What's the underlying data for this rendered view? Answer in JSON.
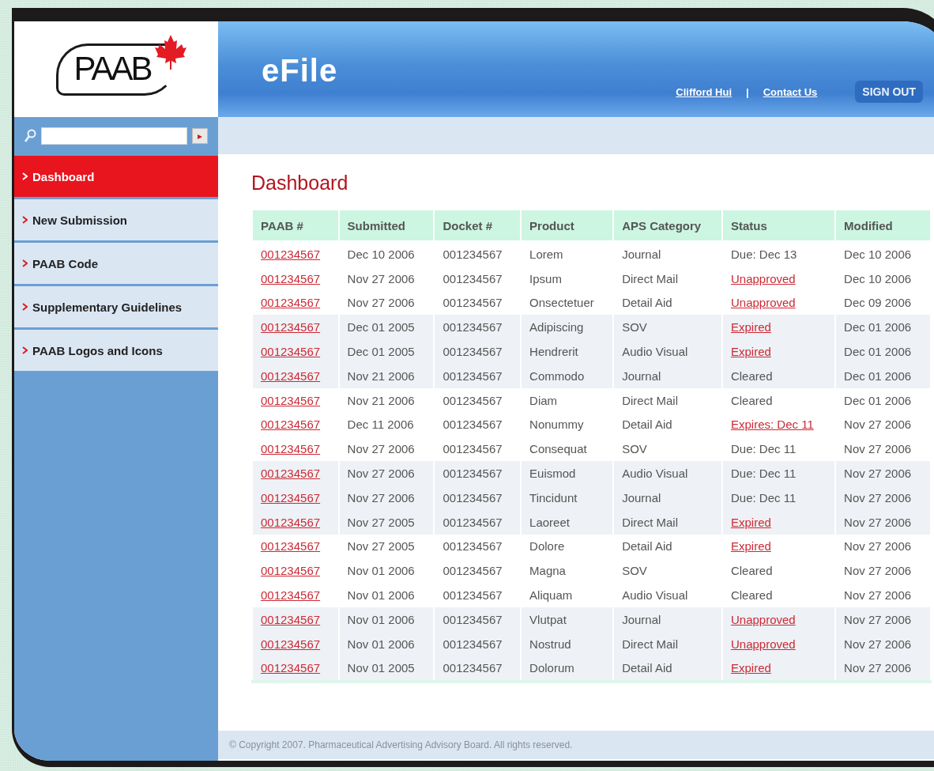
{
  "logo": {
    "text": "PAAB"
  },
  "app_title": "eFile",
  "header_links": [
    {
      "label": "Clifford Hui"
    },
    {
      "label": "Contact Us"
    }
  ],
  "header_separator": "|",
  "sign_out": "SIGN OUT",
  "search": {
    "go": "▸"
  },
  "sidebar": {
    "items": [
      {
        "label": "Dashboard",
        "selected": true
      },
      {
        "label": "New Submission",
        "selected": false
      },
      {
        "label": "PAAB Code",
        "selected": false
      },
      {
        "label": "Supplementary Guidelines",
        "selected": false
      },
      {
        "label": "PAAB Logos and Icons",
        "selected": false
      }
    ]
  },
  "page_title": "Dashboard",
  "table": {
    "columns": [
      "PAAB #",
      "Submitted",
      "Docket #",
      "Product",
      "APS Category",
      "Status",
      "Modified"
    ],
    "rows": [
      {
        "paab": "001234567",
        "submitted": "Dec 10 2006",
        "docket": "001234567",
        "product": "Lorem",
        "category": "Journal",
        "status": {
          "text": "Due: Dec 13",
          "kind": "plain"
        },
        "modified": "Dec 10 2006"
      },
      {
        "paab": "001234567",
        "submitted": "Nov 27 2006",
        "docket": "001234567",
        "product": "Ipsum",
        "category": "Direct Mail",
        "status": {
          "text": "Unapproved",
          "kind": "link"
        },
        "modified": "Dec 10 2006"
      },
      {
        "paab": "001234567",
        "submitted": "Nov 27 2006",
        "docket": "001234567",
        "product": "Onsectetuer",
        "category": "Detail Aid",
        "status": {
          "text": "Unapproved",
          "kind": "link"
        },
        "modified": "Dec 09 2006"
      },
      {
        "paab": "001234567",
        "submitted": "Dec 01 2005",
        "docket": "001234567",
        "product": "Adipiscing",
        "category": "SOV",
        "status": {
          "text": "Expired",
          "kind": "link"
        },
        "modified": "Dec 01 2006"
      },
      {
        "paab": "001234567",
        "submitted": "Dec 01 2005",
        "docket": "001234567",
        "product": "Hendrerit",
        "category": "Audio Visual",
        "status": {
          "text": "Expired",
          "kind": "link"
        },
        "modified": "Dec 01 2006"
      },
      {
        "paab": "001234567",
        "submitted": "Nov 21 2006",
        "docket": "001234567",
        "product": "Commodo",
        "category": "Journal",
        "status": {
          "text": "Cleared",
          "kind": "plain"
        },
        "modified": "Dec 01 2006"
      },
      {
        "paab": "001234567",
        "submitted": "Nov 21 2006",
        "docket": "001234567",
        "product": "Diam",
        "category": "Direct Mail",
        "status": {
          "text": "Cleared",
          "kind": "plain"
        },
        "modified": "Dec 01 2006"
      },
      {
        "paab": "001234567",
        "submitted": "Dec 11 2006",
        "docket": "001234567",
        "product": "Nonummy",
        "category": "Detail Aid",
        "status": {
          "text": "Expires: Dec 11",
          "kind": "link"
        },
        "modified": "Nov 27 2006"
      },
      {
        "paab": "001234567",
        "submitted": "Nov 27 2006",
        "docket": "001234567",
        "product": "Consequat",
        "category": "SOV",
        "status": {
          "text": "Due: Dec 11",
          "kind": "plain"
        },
        "modified": "Nov 27 2006"
      },
      {
        "paab": "001234567",
        "submitted": "Nov 27 2006",
        "docket": "001234567",
        "product": "Euismod",
        "category": "Audio Visual",
        "status": {
          "text": "Due: Dec 11",
          "kind": "plain"
        },
        "modified": "Nov 27 2006"
      },
      {
        "paab": "001234567",
        "submitted": "Nov 27 2006",
        "docket": "001234567",
        "product": "Tincidunt",
        "category": "Journal",
        "status": {
          "text": "Due: Dec 11",
          "kind": "plain"
        },
        "modified": "Nov 27 2006"
      },
      {
        "paab": "001234567",
        "submitted": "Nov 27 2005",
        "docket": "001234567",
        "product": "Laoreet",
        "category": "Direct Mail",
        "status": {
          "text": "Expired",
          "kind": "link"
        },
        "modified": "Nov 27 2006"
      },
      {
        "paab": "001234567",
        "submitted": "Nov 27 2005",
        "docket": "001234567",
        "product": "Dolore",
        "category": "Detail Aid",
        "status": {
          "text": "Expired",
          "kind": "link"
        },
        "modified": "Nov 27 2006"
      },
      {
        "paab": "001234567",
        "submitted": "Nov 01 2006",
        "docket": "001234567",
        "product": "Magna",
        "category": "SOV",
        "status": {
          "text": "Cleared",
          "kind": "plain"
        },
        "modified": "Nov 27 2006"
      },
      {
        "paab": "001234567",
        "submitted": "Nov 01 2006",
        "docket": "001234567",
        "product": "Aliquam",
        "category": "Audio Visual",
        "status": {
          "text": "Cleared",
          "kind": "plain"
        },
        "modified": "Nov 27 2006"
      },
      {
        "paab": "001234567",
        "submitted": "Nov 01 2006",
        "docket": "001234567",
        "product": "Vlutpat",
        "category": "Journal",
        "status": {
          "text": "Unapproved",
          "kind": "link"
        },
        "modified": "Nov 27 2006"
      },
      {
        "paab": "001234567",
        "submitted": "Nov 01 2006",
        "docket": "001234567",
        "product": "Nostrud",
        "category": "Direct Mail",
        "status": {
          "text": "Unapproved",
          "kind": "link"
        },
        "modified": "Nov 27 2006"
      },
      {
        "paab": "001234567",
        "submitted": "Nov 01 2005",
        "docket": "001234567",
        "product": "Dolorum",
        "category": "Detail Aid",
        "status": {
          "text": "Expired",
          "kind": "link"
        },
        "modified": "Nov 27 2006"
      }
    ]
  },
  "footer": "© Copyright 2007. Pharmaceutical Advertising Advisory Board. All rights reserved."
}
